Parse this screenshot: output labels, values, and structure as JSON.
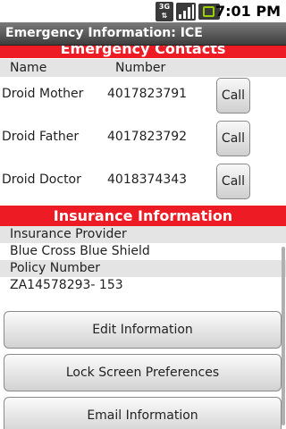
{
  "status_bar": {
    "network_label": "3G",
    "time": "7:01 PM",
    "icons": [
      "3g-icon",
      "signal-icon",
      "battery-icon"
    ]
  },
  "title_bar": {
    "title": "Emergency Information: ICE"
  },
  "emergency_contacts": {
    "header": "Emergency Contacts",
    "columns": [
      "Name",
      "Number"
    ],
    "contacts": [
      {
        "name": "Droid Mother",
        "number": "4017823791",
        "action": "Call"
      },
      {
        "name": "Droid Father",
        "number": "4017823792",
        "action": "Call"
      },
      {
        "name": "Droid Doctor",
        "number": "4018374343",
        "action": "Call"
      }
    ]
  },
  "insurance": {
    "header": "Insurance Information",
    "provider_label": "Insurance Provider",
    "provider_value": "Blue Cross Blue Shield",
    "policy_label": "Policy Number",
    "policy_value": "ZA14578293- 153"
  },
  "actions": {
    "edit": "Edit Information",
    "lock": "Lock Screen Preferences",
    "email": "Email Information"
  },
  "colors": {
    "accent_red": "#ed1c24",
    "title_bar": "#555555",
    "row_label_bg": "#e4e4e4"
  }
}
